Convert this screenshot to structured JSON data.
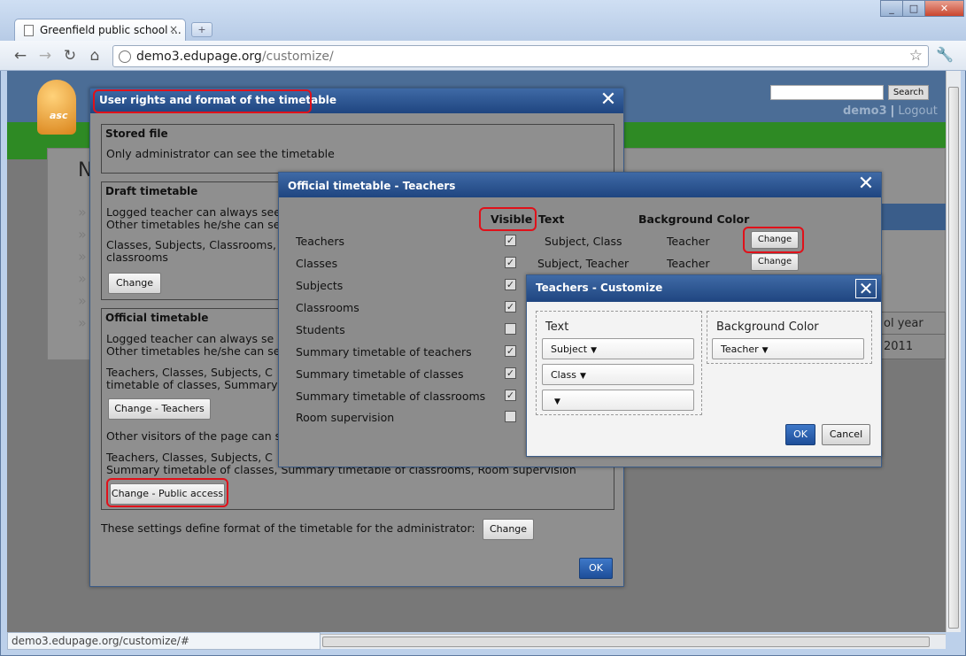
{
  "browser": {
    "tab_title": "Greenfield public school ...",
    "tab_close": "×",
    "new_tab": "+",
    "url_host": "demo3.edupage.org",
    "url_path": "/customize/",
    "status_url": "demo3.edupage.org/customize/#",
    "icons": [
      "back-icon",
      "forward-icon",
      "reload-icon",
      "home-icon",
      "star-icon",
      "wrench-icon"
    ],
    "win_min": "_",
    "win_max": "□",
    "win_close": "✕"
  },
  "site": {
    "search_button": "Search",
    "username": "demo3",
    "separator": "|",
    "logout": "Logout",
    "logo_text": "asc",
    "heading_initial": "N",
    "table_header_fragment": "ol year",
    "table_cell_fragment": "2011"
  },
  "dialog_rights": {
    "title": "User rights and format of the timetable",
    "stored_heading": "Stored file",
    "stored_line": "Only administrator can see the timetable",
    "draft_heading": "Draft timetable",
    "draft_line1": "Logged teacher can always see",
    "draft_line2": "Other timetables he/she can se",
    "draft_line3": "Classes, Subjects, Classrooms,",
    "draft_line4": "classrooms",
    "draft_change": "Change",
    "official_heading": "Official timetable",
    "official_line1": "Logged teacher can always se",
    "official_line2": "Other timetables he/she can se",
    "official_line3": "Teachers, Classes, Subjects, C",
    "official_line4": "timetable of classes, Summary",
    "change_teachers": "Change - Teachers",
    "other_visitors": "Other visitors of the page can s",
    "public_line1": "Teachers, Classes, Subjects, C",
    "public_line2": "Summary timetable of classes, Summary timetable of classrooms, Room supervision",
    "change_public": "Change - Public access",
    "settings_line": "These settings define format of the timetable for the administrator:",
    "settings_change": "Change",
    "ok": "OK"
  },
  "dialog_teachers": {
    "title": "Official timetable - Teachers",
    "col_visible": "Visible",
    "col_text": "Text",
    "col_bg": "Background Color",
    "rows": [
      {
        "label": "Teachers",
        "checked": true,
        "text": "Subject, Class",
        "bg": "Teacher",
        "change": "Change"
      },
      {
        "label": "Classes",
        "checked": true,
        "text": "Subject, Teacher",
        "bg": "Teacher",
        "change": "Change"
      },
      {
        "label": "Subjects",
        "checked": true
      },
      {
        "label": "Classrooms",
        "checked": true
      },
      {
        "label": "Students",
        "checked": false
      },
      {
        "label": "Summary timetable of teachers",
        "checked": true
      },
      {
        "label": "Summary timetable of classes",
        "checked": true
      },
      {
        "label": "Summary timetable of classrooms",
        "checked": true
      },
      {
        "label": "Room supervision",
        "checked": false
      }
    ]
  },
  "dialog_customize": {
    "title": "Teachers - Customize",
    "text_legend": "Text",
    "text_selects": [
      "Subject",
      "Class",
      ""
    ],
    "bg_legend": "Background Color",
    "bg_select": "Teacher",
    "ok": "OK",
    "cancel": "Cancel"
  },
  "colors": {
    "dialog_header": "#1f4580",
    "highlight": "#e0111a",
    "ok_button": "#2a5fae"
  }
}
